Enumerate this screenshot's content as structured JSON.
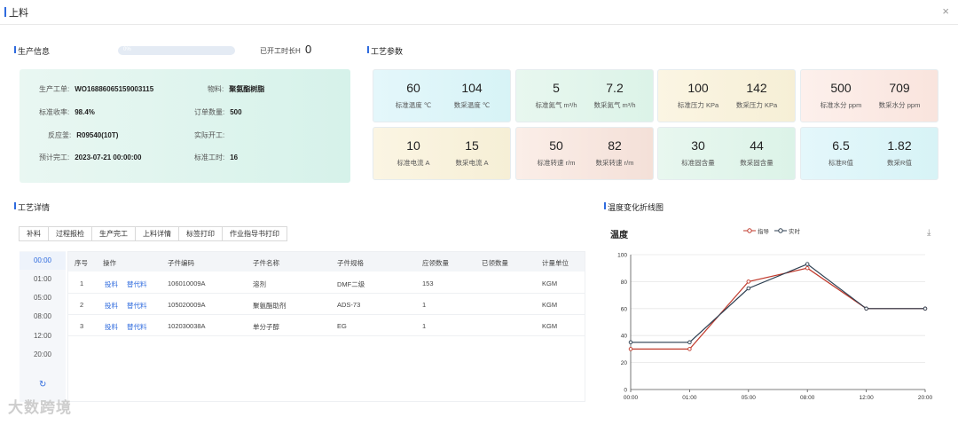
{
  "dialog": {
    "title": "上料",
    "close": "×"
  },
  "production": {
    "section_title": "生产信息",
    "progress_text": "0%",
    "progress_fraction": 0,
    "hours_label": "已开工时长H",
    "hours_value": "0",
    "rows": [
      {
        "label": "生产工单:",
        "value": "WO16886065159003115"
      },
      {
        "label": "标准收率:",
        "value": "98.4%"
      },
      {
        "label": "反应釜:",
        "value": "R09540(10T)"
      },
      {
        "label": "预计完工:",
        "value": "2023-07-21 00:00:00"
      },
      {
        "label": "物料:",
        "value": "聚氨酯树脂"
      },
      {
        "label": "订单数量:",
        "value": "500"
      },
      {
        "label": "实际开工:",
        "value": ""
      },
      {
        "label": "标准工时:",
        "value": "16"
      }
    ]
  },
  "params": {
    "section_title": "工艺参数",
    "cards": [
      {
        "std": "60",
        "std_label": "标准温度 ℃",
        "act": "104",
        "act_label": "数采温度 ℃"
      },
      {
        "std": "5",
        "std_label": "标准氮气 m³/h",
        "act": "7.2",
        "act_label": "数采氮气 m³/h"
      },
      {
        "std": "100",
        "std_label": "标准压力 KPa",
        "act": "142",
        "act_label": "数采压力 KPa"
      },
      {
        "std": "500",
        "std_label": "标准水分 ppm",
        "act": "709",
        "act_label": "数采水分 ppm"
      },
      {
        "std": "10",
        "std_label": "标准电流 A",
        "act": "15",
        "act_label": "数采电流 A"
      },
      {
        "std": "50",
        "std_label": "标准转速 r/m",
        "act": "82",
        "act_label": "数采转速 r/m"
      },
      {
        "std": "30",
        "std_label": "标准固含量",
        "act": "44",
        "act_label": "数采固含量"
      },
      {
        "std": "6.5",
        "std_label": "标准R值",
        "act": "1.82",
        "act_label": "数采R值"
      }
    ]
  },
  "details": {
    "section_title": "工艺详情",
    "buttons": [
      "补料",
      "过程报检",
      "生产完工",
      "上料详情",
      "标签打印",
      "作业指导书打印"
    ],
    "times": [
      "00:00",
      "01:00",
      "05:00",
      "08:00",
      "12:00",
      "20:00"
    ],
    "refresh_icon": "↻",
    "columns": [
      "序号",
      "操作",
      "子件编码",
      "子件名称",
      "子件规格",
      "应领数量",
      "已领数量",
      "计量单位"
    ],
    "rows": [
      {
        "no": "1",
        "op1": "投料",
        "op2": "替代料",
        "code": "106010009A",
        "name": "溶剂",
        "spec": "DMF二级",
        "qty": "153",
        "got": "",
        "unit": "KGM"
      },
      {
        "no": "2",
        "op1": "投料",
        "op2": "替代料",
        "code": "105020009A",
        "name": "聚氨酯助剂",
        "spec": "ADS-73",
        "qty": "1",
        "got": "",
        "unit": "KGM"
      },
      {
        "no": "3",
        "op1": "投料",
        "op2": "替代料",
        "code": "102030038A",
        "name": "单分子醇",
        "spec": "EG",
        "qty": "1",
        "got": "",
        "unit": "KGM"
      }
    ]
  },
  "chart_section_title": "温度变化折线图",
  "chart_data": {
    "type": "line",
    "title": "温度",
    "categories": [
      "00:00",
      "01:00",
      "05:00",
      "08:00",
      "12:00",
      "20:00"
    ],
    "ylim": [
      0,
      100
    ],
    "yticks": [
      0,
      20,
      40,
      60,
      80,
      100
    ],
    "grid": true,
    "legend": "top-center",
    "series": [
      {
        "name": "指导",
        "color": "#c0392b",
        "values": [
          30,
          30,
          80,
          90,
          60,
          60
        ]
      },
      {
        "name": "实时",
        "color": "#2c3e50",
        "values": [
          35,
          35,
          75,
          93,
          60,
          60
        ]
      }
    ]
  },
  "watermark": "大数跨境",
  "icons": {
    "download": "download-icon",
    "close": "close-icon",
    "refresh": "refresh-icon"
  }
}
